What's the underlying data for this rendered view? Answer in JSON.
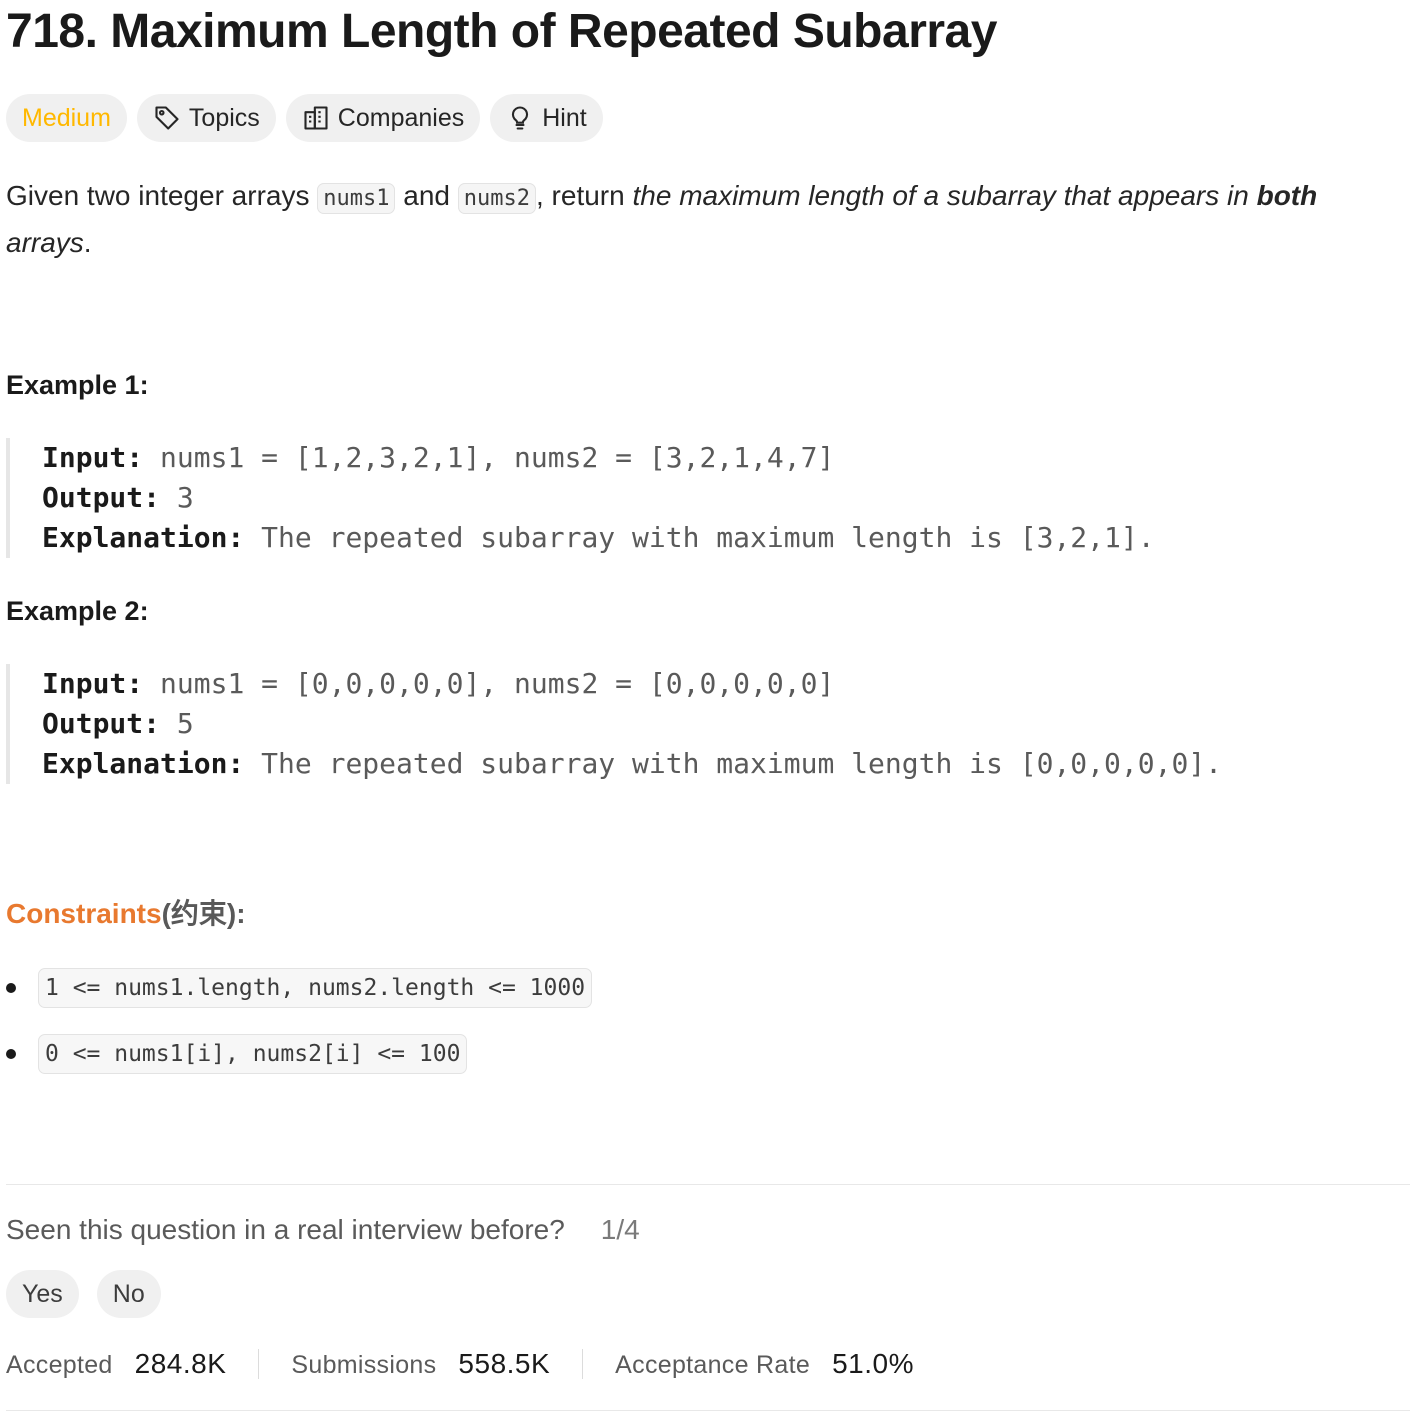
{
  "problem": {
    "number": "718.",
    "title": "Maximum Length of Repeated Subarray"
  },
  "chips": {
    "difficulty": "Medium",
    "topics": "Topics",
    "companies": "Companies",
    "hint": "Hint"
  },
  "description": {
    "p1": "Given two integer arrays ",
    "code1": "nums1",
    "p2": " and ",
    "code2": "nums2",
    "p3": ", return ",
    "em1": "the maximum length of a subarray that appears in ",
    "strong": "both",
    "em2": " arrays",
    "p4": "."
  },
  "examples": [
    {
      "heading": "Example 1:",
      "input_label": "Input:",
      "input_value": " nums1 = [1,2,3,2,1], nums2 = [3,2,1,4,7]",
      "output_label": "Output:",
      "output_value": " 3",
      "explanation_label": "Explanation:",
      "explanation_value": " The repeated subarray with maximum length is [3,2,1]."
    },
    {
      "heading": "Example 2:",
      "input_label": "Input:",
      "input_value": " nums1 = [0,0,0,0,0], nums2 = [0,0,0,0,0]",
      "output_label": "Output:",
      "output_value": " 5",
      "explanation_label": "Explanation:",
      "explanation_value": " The repeated subarray with maximum length is [0,0,0,0,0]."
    }
  ],
  "constraints": {
    "heading": "Constraints",
    "heading_suffix": "(约束):",
    "items": [
      "1 <= nums1.length, nums2.length <= 1000",
      "0 <= nums1[i], nums2[i] <= 100"
    ]
  },
  "interview": {
    "question": "Seen this question in a real interview before?",
    "count": "1/4",
    "yes": "Yes",
    "no": "No"
  },
  "stats": {
    "accepted_label": "Accepted",
    "accepted_value": "284.8K",
    "submissions_label": "Submissions",
    "submissions_value": "558.5K",
    "rate_label": "Acceptance Rate",
    "rate_value": "51.0%"
  },
  "colors": {
    "difficulty_medium": "#ffb800",
    "constraints_accent": "#e8792f"
  },
  "icons": {
    "topics": "tag-icon",
    "companies": "building-icon",
    "hint": "lightbulb-icon"
  }
}
